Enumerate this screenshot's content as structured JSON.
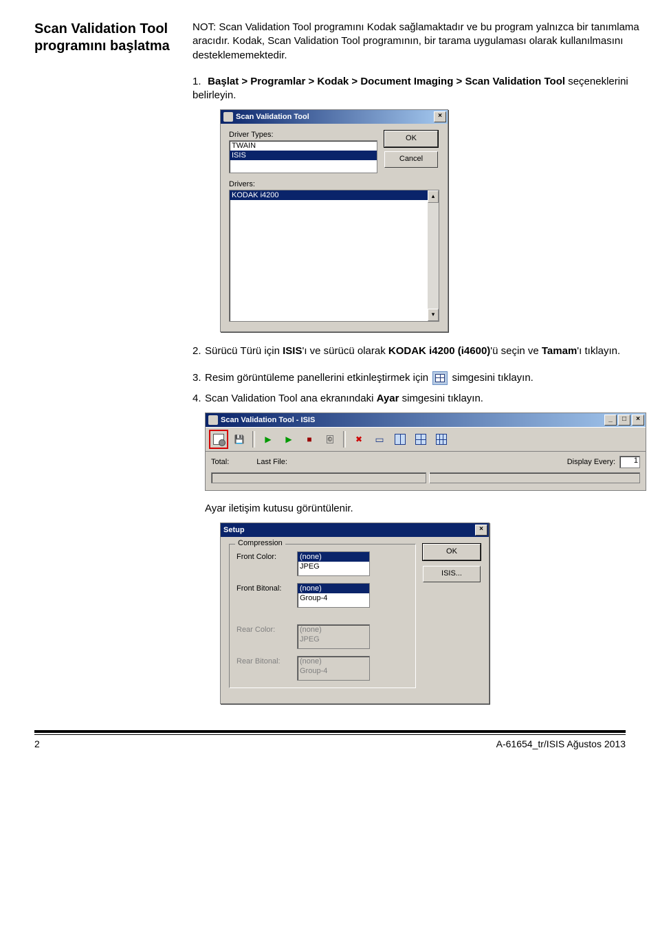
{
  "heading": "Scan Validation Tool programını başlatma",
  "note_para": "NOT: Scan Validation Tool programını Kodak sağlamaktadır ve bu program yalnızca bir tanımlama aracıdır. Kodak, Scan Validation Tool programının, bir tarama uygulaması olarak kullanılmasını desteklememektedir.",
  "steps": {
    "s1_num": "1.",
    "s1_pre": "Başlat > Programlar > Kodak > Document Imaging > Scan Validation Tool",
    "s1_post": " seçeneklerini belirleyin.",
    "s2_num": "2.",
    "s2_a": "Sürücü Türü için ",
    "s2_b": "ISIS",
    "s2_c": "'ı ve sürücü olarak ",
    "s2_d": "KODAK i4200 (i4600)",
    "s2_e": "'ü seçin ve ",
    "s2_f": "Tamam",
    "s2_g": "'ı tıklayın.",
    "s3_num": "3.",
    "s3_a": "Resim görüntüleme panellerini etkinleştirmek için ",
    "s3_b": " simgesini tıklayın.",
    "s4_num": "4.",
    "s4_a": "Scan Validation Tool ana ekranındaki ",
    "s4_b": "Ayar",
    "s4_c": " simgesini tıklayın.",
    "sub": "Ayar iletişim kutusu görüntülenir."
  },
  "svt": {
    "title": "Scan Validation Tool",
    "close_glyph": "×",
    "driver_types_label": "Driver Types:",
    "types": {
      "twain": "TWAIN",
      "isis": "ISIS"
    },
    "drivers_label": "Drivers:",
    "drivers": {
      "selected": "KODAK i4200"
    },
    "ok": "OK",
    "cancel": "Cancel",
    "scroll_up": "▴",
    "scroll_down": "▾"
  },
  "toolbar": {
    "title": "Scan Validation Tool - ISIS",
    "min": "_",
    "max": "□",
    "close": "×",
    "save_glyph": "💾",
    "play_glyph": "▶",
    "stop_glyph": "■",
    "x_glyph": "✖",
    "rect_glyph": "▭",
    "total_label": "Total:",
    "lastfile_label": "Last File:",
    "display_every_label": "Display Every:",
    "display_every_value": "1"
  },
  "setup": {
    "title": "Setup",
    "close_glyph": "×",
    "legend": "Compression",
    "front_color_label": "Front Color:",
    "front_bitonal_label": "Front Bitonal:",
    "rear_color_label": "Rear Color:",
    "rear_bitonal_label": "Rear Bitonal:",
    "opts": {
      "none": "(none)",
      "jpeg": "JPEG",
      "group4": "Group-4"
    },
    "ok": "OK",
    "isis": "ISIS..."
  },
  "footer": {
    "page": "2",
    "doc": "A-61654_tr/ISIS Ağustos 2013"
  }
}
